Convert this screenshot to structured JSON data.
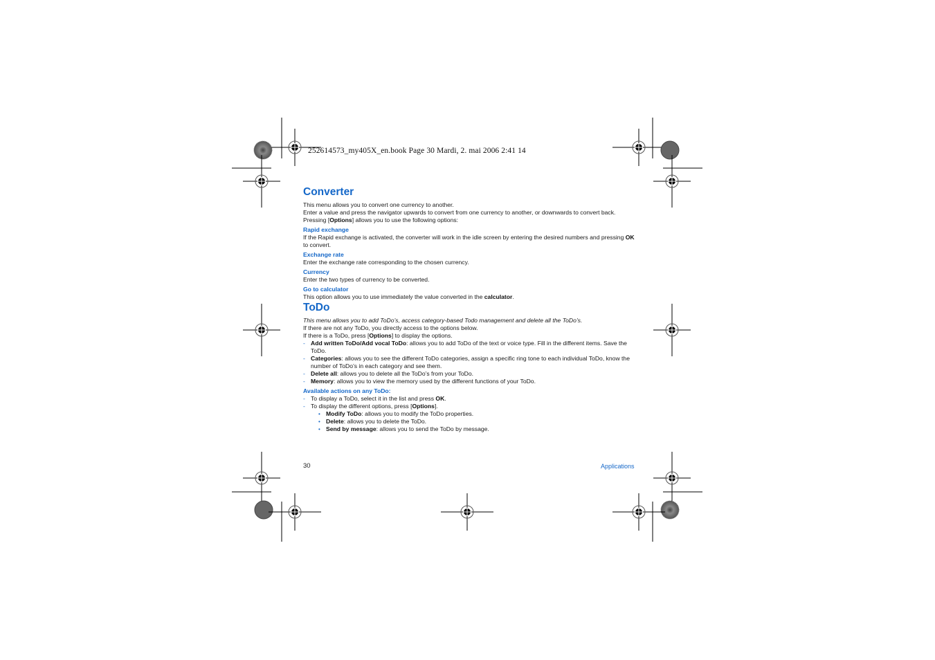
{
  "header": {
    "print_info": "252614573_my405X_en.book  Page 30  Mardi, 2. mai 2006  2:41 14"
  },
  "converter": {
    "title": "Converter",
    "intro": [
      "This menu allows you to convert one currency to another.",
      "Enter a value and press the navigator upwards to convert from one currency to another, or downwards to convert back."
    ],
    "pressing": {
      "before": "Pressing [",
      "bold": "Options",
      "after": "] allows you to use the following options:"
    },
    "options": [
      {
        "heading": "Rapid exchange",
        "text_before": "If the Rapid exchange is activated, the converter will work in the idle screen by entering the desired numbers and pressing ",
        "bold": "OK",
        "text_after": " to convert."
      },
      {
        "heading": "Exchange rate",
        "text_before": "Enter the exchange rate corresponding to the chosen currency.",
        "bold": "",
        "text_after": ""
      },
      {
        "heading": "Currency",
        "text_before": "Enter the two types of currency to be converted.",
        "bold": "",
        "text_after": ""
      },
      {
        "heading": "Go to calculator",
        "text_before": "This option allows you to use immediately the value converted in the ",
        "bold": "calculator",
        "text_after": "."
      }
    ]
  },
  "todo": {
    "title": "ToDo",
    "intro_italic": "This menu allows you to add ToDo’s, access category-based Todo management and delete all the ToDo’s.",
    "line1": "If there are not any ToDo, you directly access to the options below.",
    "line2": {
      "before": "If there is a ToDo, press [",
      "bold": "Options",
      "after": "] to display the options."
    },
    "bullet_marker": "-",
    "items": [
      {
        "bold": "Add written ToDo/Add vocal ToDo",
        "text": ": allows you to add ToDo of the text or voice type. Fill in the different items. Save the ToDo."
      },
      {
        "bold": "Categories",
        "text": ": allows you to see the different ToDo categories, assign a specific ring tone to each individual ToDo, know the number of ToDo’s in each category and see them."
      },
      {
        "bold": "Delete all",
        "text": ": allows you to delete all the ToDo’s from your ToDo."
      },
      {
        "bold": "Memory",
        "text": ": allows you to view the memory used by the different functions of your ToDo."
      }
    ],
    "actions_heading": "Available actions on any ToDo:",
    "actions": [
      {
        "before": "To display a ToDo, select it in the list and press ",
        "bold": "OK",
        "after": "."
      },
      {
        "before": "To display the different options, press [",
        "bold": "Options",
        "after": "]."
      }
    ],
    "sub_marker": "•",
    "sub_actions": [
      {
        "bold": "Modify ToDo",
        "text": ": allows you to modify the ToDo properties."
      },
      {
        "bold": "Delete",
        "text": ": allows you to delete the ToDo."
      },
      {
        "bold": "Send by message",
        "text": ": allows you to send the ToDo by message."
      }
    ]
  },
  "footer": {
    "page_number": "30",
    "section": "Applications"
  },
  "colors": {
    "accent": "#1467c8",
    "text": "#1a1a1a"
  }
}
